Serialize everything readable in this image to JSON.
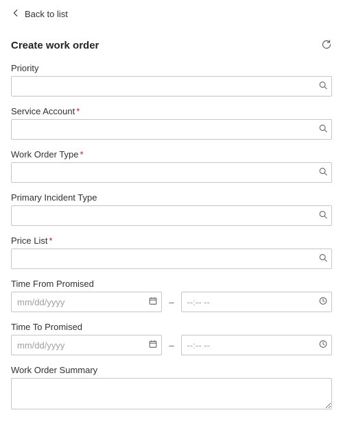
{
  "nav": {
    "back_label": "Back to list"
  },
  "header": {
    "title": "Create work order"
  },
  "fields": {
    "priority": {
      "label": "Priority",
      "value": ""
    },
    "service_account": {
      "label": "Service Account",
      "value": ""
    },
    "work_order_type": {
      "label": "Work Order Type",
      "value": ""
    },
    "primary_incident_type": {
      "label": "Primary Incident Type",
      "value": ""
    },
    "price_list": {
      "label": "Price List",
      "value": ""
    },
    "time_from": {
      "label": "Time From Promised",
      "date_placeholder": "mm/dd/yyyy",
      "date_value": "",
      "time_placeholder": "--:-- --",
      "time_value": ""
    },
    "time_to": {
      "label": "Time To Promised",
      "date_placeholder": "mm/dd/yyyy",
      "date_value": "",
      "time_placeholder": "--:-- --",
      "time_value": ""
    },
    "summary": {
      "label": "Work Order Summary",
      "value": ""
    },
    "dash": "–",
    "required_mark": "*"
  }
}
